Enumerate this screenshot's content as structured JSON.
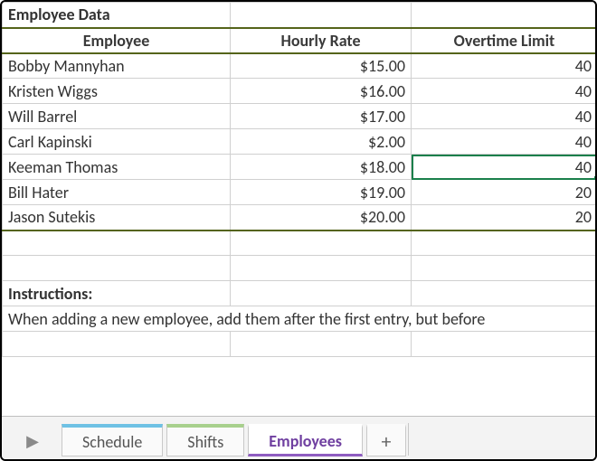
{
  "title": "Employee Data",
  "columns": [
    "Employee",
    "Hourly Rate",
    "Overtime Limit"
  ],
  "rows": [
    {
      "name": "Bobby Mannyhan",
      "rate": "$15.00",
      "ot": "40"
    },
    {
      "name": "Kristen Wiggs",
      "rate": "$16.00",
      "ot": "40"
    },
    {
      "name": "Will Barrel",
      "rate": "$17.00",
      "ot": "40"
    },
    {
      "name": "Carl Kapinski",
      "rate": "$2.00",
      "ot": "40"
    },
    {
      "name": "Keeman Thomas",
      "rate": "$18.00",
      "ot": "40"
    },
    {
      "name": "Bill Hater",
      "rate": "$19.00",
      "ot": "20"
    },
    {
      "name": "Jason Sutekis",
      "rate": "$20.00",
      "ot": "20"
    }
  ],
  "selected_cell": {
    "row_index": 4,
    "col": "ot"
  },
  "instructions_label": "Instructions:",
  "instructions_text": "When adding a new employee, add them after the first entry, but before",
  "tabs": {
    "schedule": "Schedule",
    "shifts": "Shifts",
    "employees": "Employees",
    "add": "+"
  },
  "active_tab": "employees"
}
